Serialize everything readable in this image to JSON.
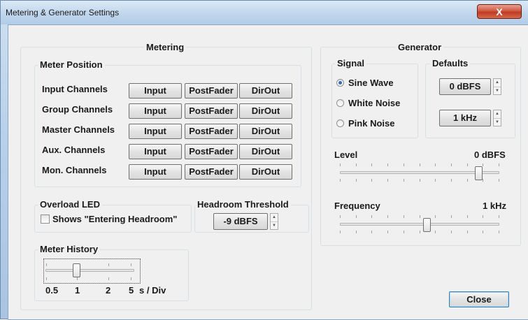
{
  "window": {
    "title": "Metering & Generator Settings",
    "close_glyph": "X"
  },
  "metering": {
    "title": "Metering",
    "meter_position": {
      "title": "Meter Position",
      "rows": [
        {
          "label": "Input Channels",
          "buttons": [
            "Input",
            "PostFader",
            "DirOut"
          ]
        },
        {
          "label": "Group Channels",
          "buttons": [
            "Input",
            "PostFader",
            "DirOut"
          ]
        },
        {
          "label": "Master Channels",
          "buttons": [
            "Input",
            "PostFader",
            "DirOut"
          ]
        },
        {
          "label": "Aux. Channels",
          "buttons": [
            "Input",
            "PostFader",
            "DirOut"
          ]
        },
        {
          "label": "Mon. Channels",
          "buttons": [
            "Input",
            "PostFader",
            "DirOut"
          ]
        }
      ]
    },
    "overload_led": {
      "title": "Overload LED",
      "checkbox_label": "Shows \"Entering Headroom\"",
      "checked": false
    },
    "headroom_threshold": {
      "title": "Headroom Threshold",
      "value": "-9 dBFS"
    },
    "meter_history": {
      "title": "Meter History",
      "tick_labels": [
        "0.5",
        "1",
        "2",
        "5"
      ],
      "unit": "s / Div",
      "selected": "1"
    }
  },
  "generator": {
    "title": "Generator",
    "signal": {
      "title": "Signal",
      "options": [
        "Sine Wave",
        "White Noise",
        "Pink Noise"
      ],
      "selected": "Sine Wave"
    },
    "defaults": {
      "title": "Defaults",
      "level_value": "0 dBFS",
      "frequency_value": "1 kHz"
    },
    "level": {
      "label": "Level",
      "value_text": "0 dBFS",
      "position_fraction": 0.89
    },
    "frequency": {
      "label": "Frequency",
      "value_text": "1 kHz",
      "position_fraction": 0.55
    }
  },
  "footer": {
    "close_label": "Close"
  },
  "icons": {
    "spin_up": "▲",
    "spin_down": "▼"
  }
}
